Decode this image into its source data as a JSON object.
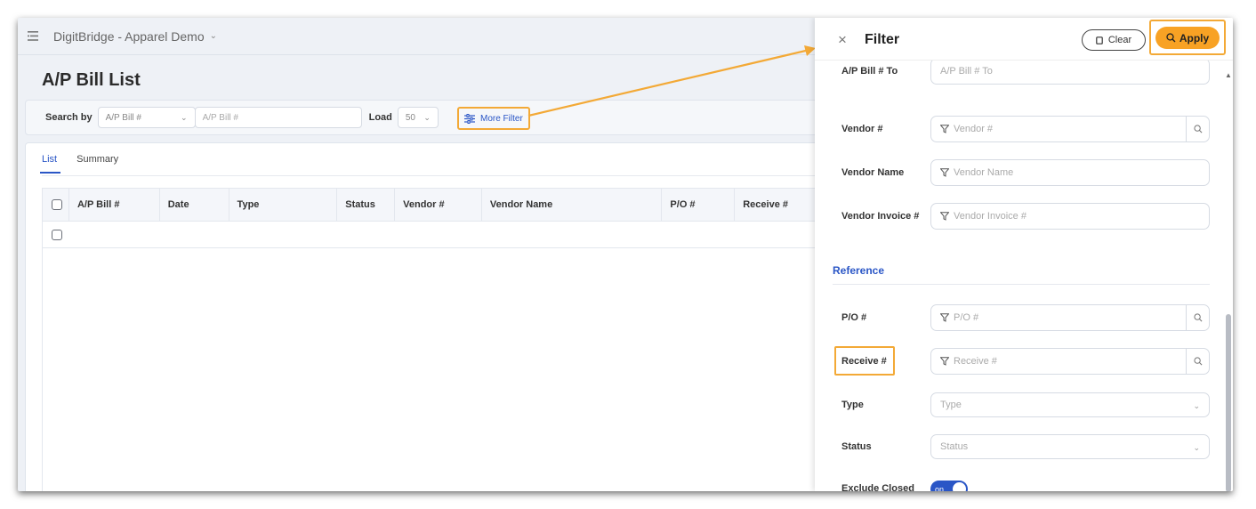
{
  "app": {
    "title": "DigitBridge - Apparel Demo"
  },
  "page": {
    "title": "A/P Bill List"
  },
  "search": {
    "search_by_label": "Search by",
    "search_by_value": "A/P Bill #",
    "input_placeholder": "A/P Bill #",
    "load_label": "Load",
    "load_value": "50",
    "more_filter_label": "More Filter"
  },
  "tabs": [
    {
      "label": "List",
      "active": true
    },
    {
      "label": "Summary",
      "active": false
    }
  ],
  "table": {
    "columns": [
      "A/P Bill #",
      "Date",
      "Type",
      "Status",
      "Vendor #",
      "Vendor Name",
      "P/O #",
      "Receive #"
    ]
  },
  "filter": {
    "title": "Filter",
    "clear_label": "Clear",
    "apply_label": "Apply",
    "fields": [
      {
        "label": "A/P Bill # To",
        "placeholder": "A/P Bill # To"
      },
      {
        "label": "Vendor #",
        "placeholder": "Vendor #"
      },
      {
        "label": "Vendor Name",
        "placeholder": "Vendor Name"
      },
      {
        "label": "Vendor Invoice #",
        "placeholder": "Vendor Invoice #"
      }
    ],
    "section_reference": "Reference",
    "ref_fields": [
      {
        "label": "P/O #",
        "placeholder": "P/O #"
      },
      {
        "label": "Receive #",
        "placeholder": "Receive #"
      },
      {
        "label": "Type",
        "placeholder": "Type"
      },
      {
        "label": "Status",
        "placeholder": "Status"
      }
    ],
    "exclude_closed_label": "Exclude Closed",
    "exclude_closed_value": "on"
  },
  "colors": {
    "accent": "#2a56c6",
    "highlight": "#f3a936",
    "apply": "#f8a224"
  }
}
